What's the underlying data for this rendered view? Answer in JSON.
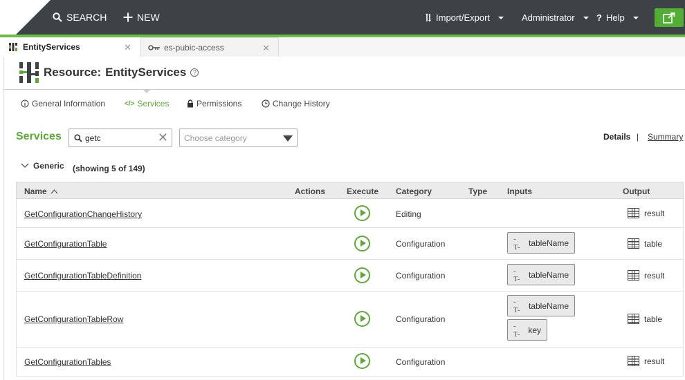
{
  "topbar": {
    "search_label": "SEARCH",
    "new_label": "NEW",
    "import_export_label": "Import/Export",
    "user_label": "Administrator",
    "help_label": "Help",
    "accent_color": "#6cbd45"
  },
  "tabs": [
    {
      "label": "EntityServices",
      "active": true
    },
    {
      "label": "es-pubic-access",
      "active": false
    }
  ],
  "resource": {
    "prefix": "Resource:",
    "name": "EntityServices"
  },
  "subnav": {
    "general": "General Information",
    "services": "Services",
    "permissions": "Permissions",
    "history": "Change History"
  },
  "services": {
    "title": "Services",
    "search_value": "getc",
    "category_placeholder": "Choose category",
    "details_label": "Details",
    "separator": "|",
    "summary_label": "Summary"
  },
  "group": {
    "name": "Generic",
    "count_text": "(showing 5 of 149)"
  },
  "table": {
    "headers": {
      "name": "Name",
      "actions": "Actions",
      "execute": "Execute",
      "category": "Category",
      "type": "Type",
      "inputs": "Inputs",
      "output": "Output"
    },
    "rows": [
      {
        "name": "GetConfigurationChangeHistory",
        "category": "Editing",
        "inputs": [],
        "output": "result"
      },
      {
        "name": "GetConfigurationTable",
        "category": "Configuration",
        "inputs": [
          "tableName"
        ],
        "output": "table"
      },
      {
        "name": "GetConfigurationTableDefinition",
        "category": "Configuration",
        "inputs": [
          "tableName"
        ],
        "output": "result"
      },
      {
        "name": "GetConfigurationTableRow",
        "category": "Configuration",
        "inputs": [
          "tableName",
          "key"
        ],
        "output": "table"
      },
      {
        "name": "GetConfigurationTables",
        "category": "Configuration",
        "inputs": [],
        "output": "result"
      }
    ]
  }
}
